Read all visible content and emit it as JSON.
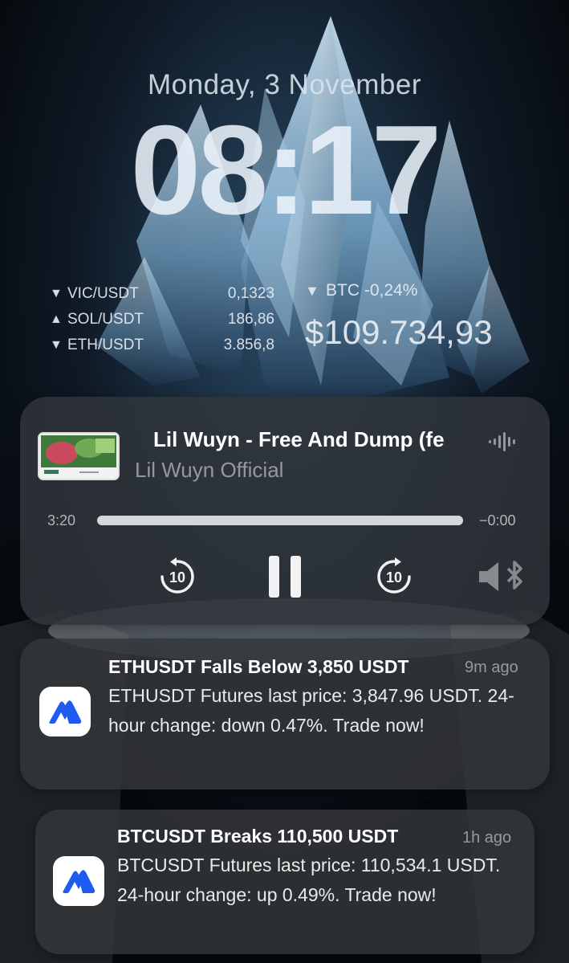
{
  "lockscreen": {
    "date": "Monday, 3 November",
    "time": "08:17"
  },
  "crypto_widget": {
    "pairs": [
      {
        "direction": "down",
        "symbol": "VIC/USDT",
        "price": "0,1323"
      },
      {
        "direction": "up",
        "symbol": "SOL/USDT",
        "price": "186,86"
      },
      {
        "direction": "down",
        "symbol": "ETH/USDT",
        "price": "3.856,8"
      }
    ],
    "btc": {
      "direction": "down",
      "change": "BTC -0,24%",
      "price": "$109.734,93"
    },
    "triangles": {
      "up": "▲",
      "down": "▼"
    }
  },
  "now_playing": {
    "title": "Lil Wuyn - Free And Dump (fe",
    "artist": "Lil Wuyn Official",
    "elapsed": "3:20",
    "remaining": "−0:00",
    "progress_fraction": 1.0,
    "skip_back_seconds": "10",
    "skip_forward_seconds": "10",
    "icons": [
      "waveform-icon",
      "skip-back-10-icon",
      "pause-icon",
      "skip-forward-10-icon",
      "speaker-bluetooth-icon"
    ]
  },
  "notifications": [
    {
      "title": "ETHUSDT Falls Below 3,850 USDT",
      "time": "9m ago",
      "body": "ETHUSDT Futures last price: 3,847.96 USDT. 24-hour change: down 0.47%. Trade now!"
    },
    {
      "title": "BTCUSDT Breaks 110,500 USDT",
      "time": "1h ago",
      "body": "BTCUSDT Futures last price: 110,534.1 USDT. 24-hour change: up 0.49%. Trade now!"
    }
  ],
  "colors": {
    "app_icon_blue": "#1e5bf0",
    "card_background": "#343638",
    "player_background": "#30343a"
  }
}
